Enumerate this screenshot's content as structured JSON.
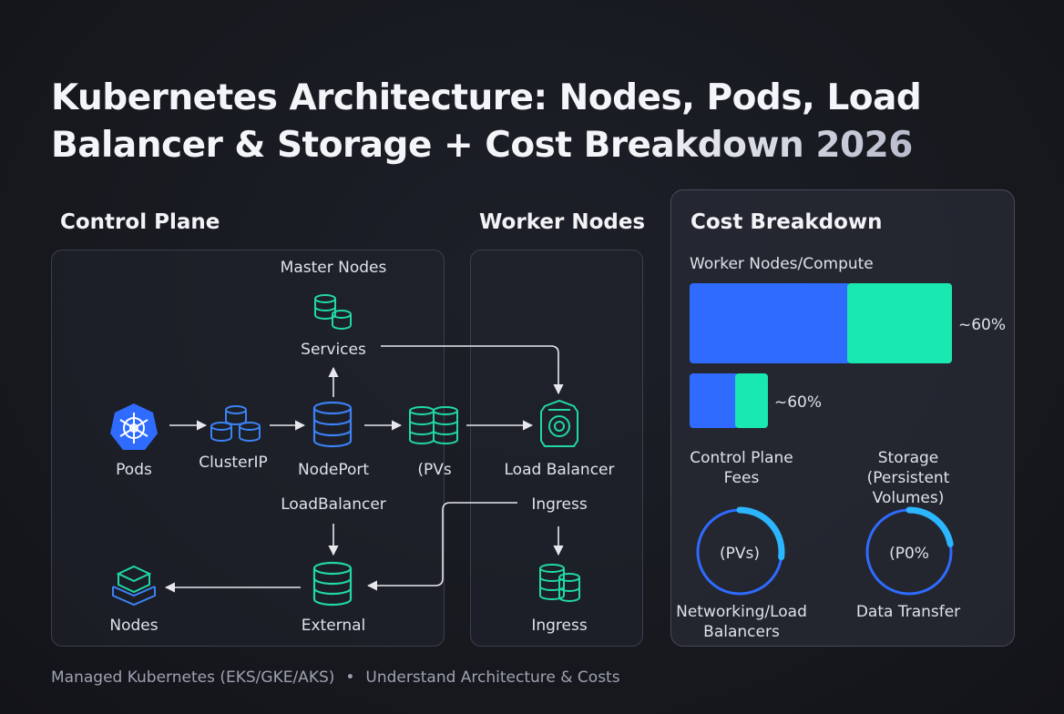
{
  "title": {
    "line1": "Kubernetes Architecture: Nodes, Pods, Load",
    "line2a": "Balancer & Storage + ",
    "line2b": "Cost Breakdown 2026"
  },
  "control_plane": {
    "heading": "Control Plane",
    "master_nodes": "Master Nodes",
    "services": "Services",
    "pods": "Pods",
    "cluster_ip": "ClusterIP",
    "node_port": "NodePort",
    "pvs": "(PVs",
    "load_balancer": "LoadBalancer",
    "nodes": "Nodes",
    "external": "External"
  },
  "worker_nodes": {
    "heading": "Worker Nodes",
    "load_balancer": "Load Balancer",
    "ingress_top": "Ingress",
    "ingress_bottom": "Ingress"
  },
  "cost": {
    "heading": "Cost Breakdown",
    "compute_label": "Worker Nodes/Compute",
    "compute_pct": "~60%",
    "compute_bar": {
      "blue_fraction": 0.6,
      "teal_fraction": 0.4
    },
    "small_pct": "~60%",
    "small_bar": {
      "blue_fraction": 0.58,
      "teal_fraction": 0.42
    },
    "control_fees": "Control Plane\nFees",
    "storage": "Storage\n(Persistent Volumes)",
    "gauge_left_text": "(PVs)",
    "gauge_left_fraction": 0.27,
    "gauge_right_text": "(P0%",
    "gauge_right_fraction": 0.22,
    "networking": "Networking/Load\nBalancers",
    "data_transfer": "Data Transfer"
  },
  "footer": {
    "left": "Managed Kubernetes (EKS/GKE/AKS)",
    "sep": "•",
    "right": "Understand Architecture & Costs"
  },
  "colors": {
    "blue": "#2f6bff",
    "teal": "#19e8b0",
    "icon_blue": "#3b82f6",
    "icon_teal": "#21d8a4"
  }
}
